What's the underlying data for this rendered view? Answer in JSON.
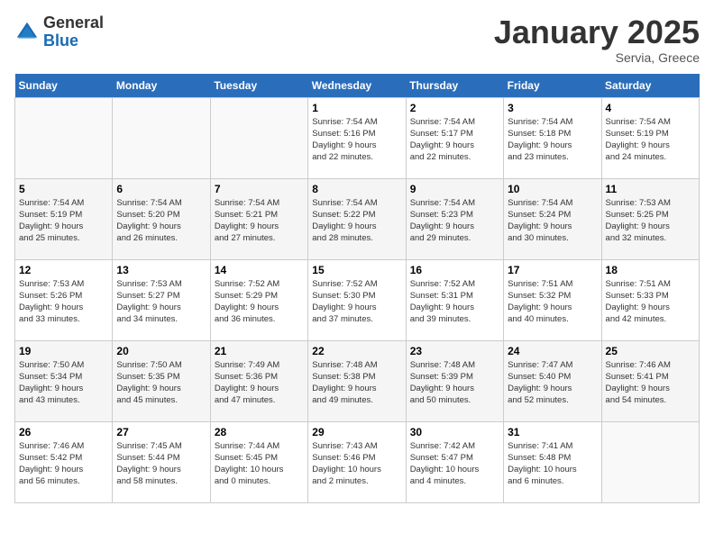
{
  "header": {
    "logo_general": "General",
    "logo_blue": "Blue",
    "title": "January 2025",
    "subtitle": "Servia, Greece"
  },
  "days_of_week": [
    "Sunday",
    "Monday",
    "Tuesday",
    "Wednesday",
    "Thursday",
    "Friday",
    "Saturday"
  ],
  "weeks": [
    [
      {
        "day": "",
        "info": ""
      },
      {
        "day": "",
        "info": ""
      },
      {
        "day": "",
        "info": ""
      },
      {
        "day": "1",
        "info": "Sunrise: 7:54 AM\nSunset: 5:16 PM\nDaylight: 9 hours\nand 22 minutes."
      },
      {
        "day": "2",
        "info": "Sunrise: 7:54 AM\nSunset: 5:17 PM\nDaylight: 9 hours\nand 22 minutes."
      },
      {
        "day": "3",
        "info": "Sunrise: 7:54 AM\nSunset: 5:18 PM\nDaylight: 9 hours\nand 23 minutes."
      },
      {
        "day": "4",
        "info": "Sunrise: 7:54 AM\nSunset: 5:19 PM\nDaylight: 9 hours\nand 24 minutes."
      }
    ],
    [
      {
        "day": "5",
        "info": "Sunrise: 7:54 AM\nSunset: 5:19 PM\nDaylight: 9 hours\nand 25 minutes."
      },
      {
        "day": "6",
        "info": "Sunrise: 7:54 AM\nSunset: 5:20 PM\nDaylight: 9 hours\nand 26 minutes."
      },
      {
        "day": "7",
        "info": "Sunrise: 7:54 AM\nSunset: 5:21 PM\nDaylight: 9 hours\nand 27 minutes."
      },
      {
        "day": "8",
        "info": "Sunrise: 7:54 AM\nSunset: 5:22 PM\nDaylight: 9 hours\nand 28 minutes."
      },
      {
        "day": "9",
        "info": "Sunrise: 7:54 AM\nSunset: 5:23 PM\nDaylight: 9 hours\nand 29 minutes."
      },
      {
        "day": "10",
        "info": "Sunrise: 7:54 AM\nSunset: 5:24 PM\nDaylight: 9 hours\nand 30 minutes."
      },
      {
        "day": "11",
        "info": "Sunrise: 7:53 AM\nSunset: 5:25 PM\nDaylight: 9 hours\nand 32 minutes."
      }
    ],
    [
      {
        "day": "12",
        "info": "Sunrise: 7:53 AM\nSunset: 5:26 PM\nDaylight: 9 hours\nand 33 minutes."
      },
      {
        "day": "13",
        "info": "Sunrise: 7:53 AM\nSunset: 5:27 PM\nDaylight: 9 hours\nand 34 minutes."
      },
      {
        "day": "14",
        "info": "Sunrise: 7:52 AM\nSunset: 5:29 PM\nDaylight: 9 hours\nand 36 minutes."
      },
      {
        "day": "15",
        "info": "Sunrise: 7:52 AM\nSunset: 5:30 PM\nDaylight: 9 hours\nand 37 minutes."
      },
      {
        "day": "16",
        "info": "Sunrise: 7:52 AM\nSunset: 5:31 PM\nDaylight: 9 hours\nand 39 minutes."
      },
      {
        "day": "17",
        "info": "Sunrise: 7:51 AM\nSunset: 5:32 PM\nDaylight: 9 hours\nand 40 minutes."
      },
      {
        "day": "18",
        "info": "Sunrise: 7:51 AM\nSunset: 5:33 PM\nDaylight: 9 hours\nand 42 minutes."
      }
    ],
    [
      {
        "day": "19",
        "info": "Sunrise: 7:50 AM\nSunset: 5:34 PM\nDaylight: 9 hours\nand 43 minutes."
      },
      {
        "day": "20",
        "info": "Sunrise: 7:50 AM\nSunset: 5:35 PM\nDaylight: 9 hours\nand 45 minutes."
      },
      {
        "day": "21",
        "info": "Sunrise: 7:49 AM\nSunset: 5:36 PM\nDaylight: 9 hours\nand 47 minutes."
      },
      {
        "day": "22",
        "info": "Sunrise: 7:48 AM\nSunset: 5:38 PM\nDaylight: 9 hours\nand 49 minutes."
      },
      {
        "day": "23",
        "info": "Sunrise: 7:48 AM\nSunset: 5:39 PM\nDaylight: 9 hours\nand 50 minutes."
      },
      {
        "day": "24",
        "info": "Sunrise: 7:47 AM\nSunset: 5:40 PM\nDaylight: 9 hours\nand 52 minutes."
      },
      {
        "day": "25",
        "info": "Sunrise: 7:46 AM\nSunset: 5:41 PM\nDaylight: 9 hours\nand 54 minutes."
      }
    ],
    [
      {
        "day": "26",
        "info": "Sunrise: 7:46 AM\nSunset: 5:42 PM\nDaylight: 9 hours\nand 56 minutes."
      },
      {
        "day": "27",
        "info": "Sunrise: 7:45 AM\nSunset: 5:44 PM\nDaylight: 9 hours\nand 58 minutes."
      },
      {
        "day": "28",
        "info": "Sunrise: 7:44 AM\nSunset: 5:45 PM\nDaylight: 10 hours\nand 0 minutes."
      },
      {
        "day": "29",
        "info": "Sunrise: 7:43 AM\nSunset: 5:46 PM\nDaylight: 10 hours\nand 2 minutes."
      },
      {
        "day": "30",
        "info": "Sunrise: 7:42 AM\nSunset: 5:47 PM\nDaylight: 10 hours\nand 4 minutes."
      },
      {
        "day": "31",
        "info": "Sunrise: 7:41 AM\nSunset: 5:48 PM\nDaylight: 10 hours\nand 6 minutes."
      },
      {
        "day": "",
        "info": ""
      }
    ]
  ]
}
